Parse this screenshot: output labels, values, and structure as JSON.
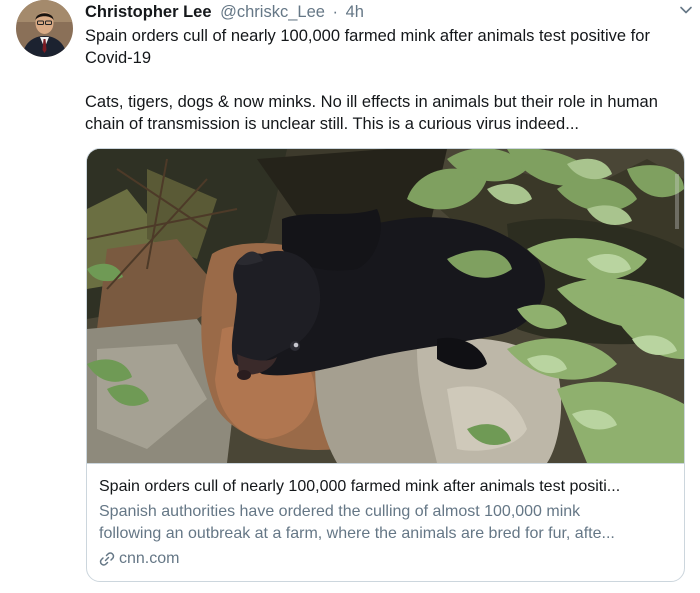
{
  "tweet": {
    "author_name": "Christopher Lee",
    "author_handle": "@chriskc_Lee",
    "separator": "·",
    "time": "4h",
    "text_line1": "Spain orders cull of nearly 100,000 farmed mink after animals test positive for Covid-19",
    "text_line2": "Cats, tigers, dogs & now minks. No ill effects in animals but their role in human chain of transmission is unclear still. This is a curious virus indeed..."
  },
  "card": {
    "title": "Spain orders cull of nearly 100,000 farmed mink after animals test positi...",
    "description_line1": "Spanish authorities have ordered the culling of almost 100,000 mink",
    "description_line2": "following an outbreak at a farm, where the animals are bred for fur, afte...",
    "domain": "cnn.com",
    "image_subject": "mink-photo"
  },
  "icons": {
    "caret": "chevron-down-icon",
    "link": "link-icon"
  },
  "colors": {
    "primary_text": "#14171a",
    "secondary_text": "#657786",
    "border": "#ccd6dd"
  }
}
